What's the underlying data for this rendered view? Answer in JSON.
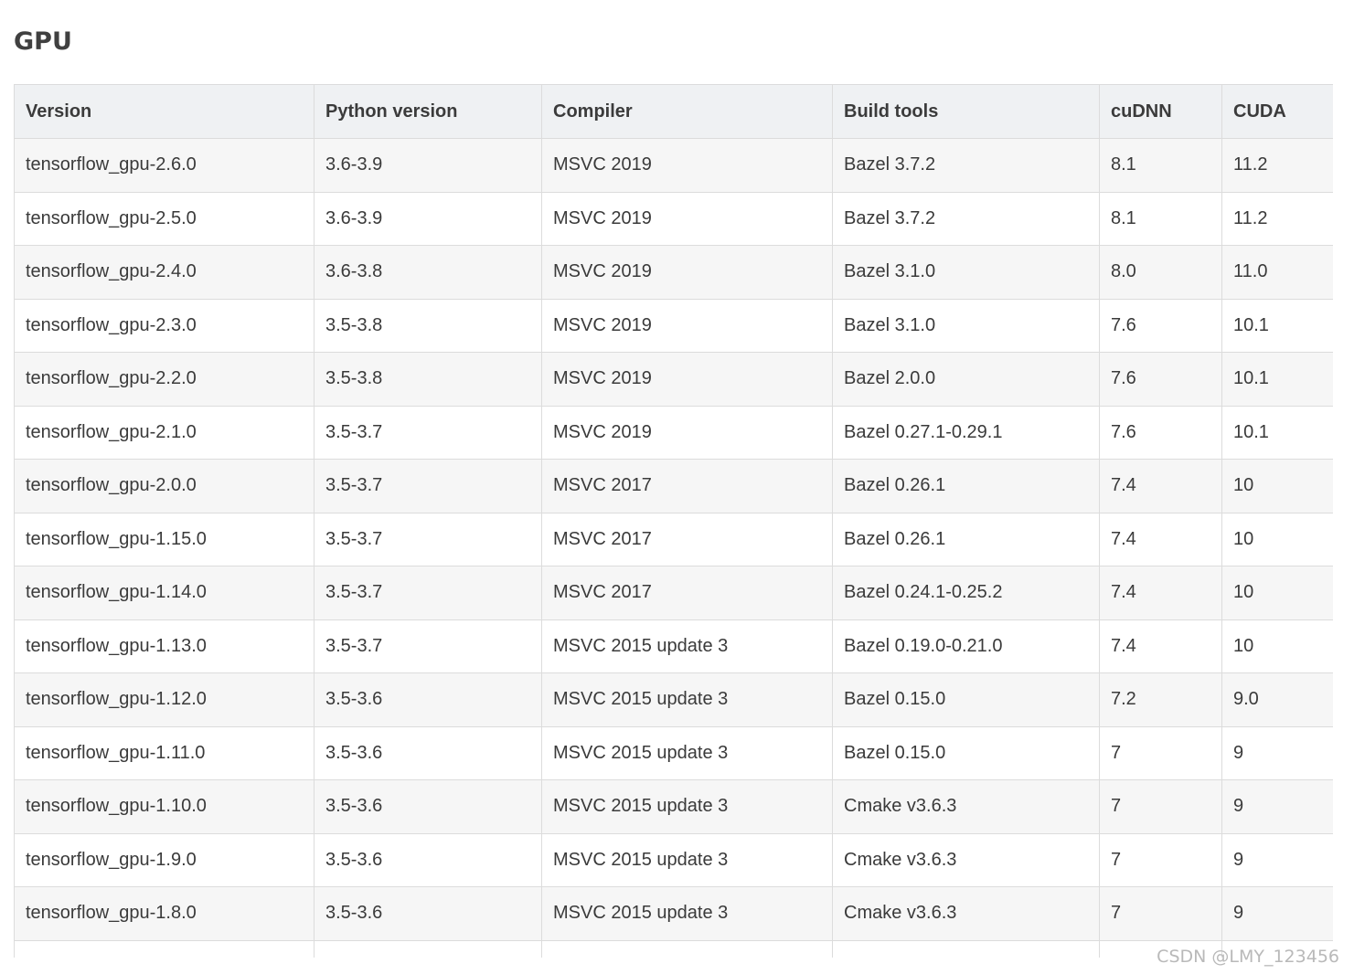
{
  "title": "GPU",
  "table": {
    "headers": [
      "Version",
      "Python version",
      "Compiler",
      "Build tools",
      "cuDNN",
      "CUDA"
    ],
    "rows": [
      [
        "tensorflow_gpu-2.6.0",
        "3.6-3.9",
        "MSVC 2019",
        "Bazel 3.7.2",
        "8.1",
        "11.2"
      ],
      [
        "tensorflow_gpu-2.5.0",
        "3.6-3.9",
        "MSVC 2019",
        "Bazel 3.7.2",
        "8.1",
        "11.2"
      ],
      [
        "tensorflow_gpu-2.4.0",
        "3.6-3.8",
        "MSVC 2019",
        "Bazel 3.1.0",
        "8.0",
        "11.0"
      ],
      [
        "tensorflow_gpu-2.3.0",
        "3.5-3.8",
        "MSVC 2019",
        "Bazel 3.1.0",
        "7.6",
        "10.1"
      ],
      [
        "tensorflow_gpu-2.2.0",
        "3.5-3.8",
        "MSVC 2019",
        "Bazel 2.0.0",
        "7.6",
        "10.1"
      ],
      [
        "tensorflow_gpu-2.1.0",
        "3.5-3.7",
        "MSVC 2019",
        "Bazel 0.27.1-0.29.1",
        "7.6",
        "10.1"
      ],
      [
        "tensorflow_gpu-2.0.0",
        "3.5-3.7",
        "MSVC 2017",
        "Bazel 0.26.1",
        "7.4",
        "10"
      ],
      [
        "tensorflow_gpu-1.15.0",
        "3.5-3.7",
        "MSVC 2017",
        "Bazel 0.26.1",
        "7.4",
        "10"
      ],
      [
        "tensorflow_gpu-1.14.0",
        "3.5-3.7",
        "MSVC 2017",
        "Bazel 0.24.1-0.25.2",
        "7.4",
        "10"
      ],
      [
        "tensorflow_gpu-1.13.0",
        "3.5-3.7",
        "MSVC 2015 update 3",
        "Bazel 0.19.0-0.21.0",
        "7.4",
        "10"
      ],
      [
        "tensorflow_gpu-1.12.0",
        "3.5-3.6",
        "MSVC 2015 update 3",
        "Bazel 0.15.0",
        "7.2",
        "9.0"
      ],
      [
        "tensorflow_gpu-1.11.0",
        "3.5-3.6",
        "MSVC 2015 update 3",
        "Bazel 0.15.0",
        "7",
        "9"
      ],
      [
        "tensorflow_gpu-1.10.0",
        "3.5-3.6",
        "MSVC 2015 update 3",
        "Cmake v3.6.3",
        "7",
        "9"
      ],
      [
        "tensorflow_gpu-1.9.0",
        "3.5-3.6",
        "MSVC 2015 update 3",
        "Cmake v3.6.3",
        "7",
        "9"
      ],
      [
        "tensorflow_gpu-1.8.0",
        "3.5-3.6",
        "MSVC 2015 update 3",
        "Cmake v3.6.3",
        "7",
        "9"
      ],
      [
        "",
        "",
        "",
        "",
        "",
        ""
      ]
    ]
  },
  "watermark": "CSDN @LMY_123456"
}
